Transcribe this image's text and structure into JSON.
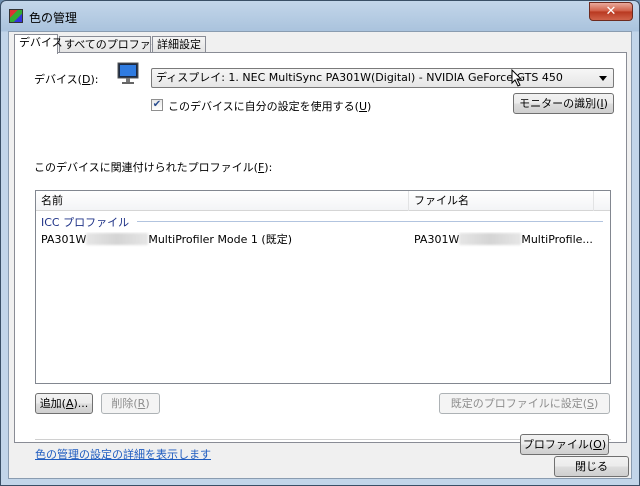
{
  "window": {
    "title": "色の管理",
    "close_label": "✕"
  },
  "tabs": [
    {
      "label": "デバイス",
      "active": true
    },
    {
      "label": "すべてのプロファイル",
      "active": false
    },
    {
      "label": "詳細設定",
      "active": false
    }
  ],
  "device": {
    "label_prefix": "デバイス(",
    "label_key": "D",
    "label_suffix": "):",
    "selected": "ディスプレイ: 1. NEC MultiSync PA301W(Digital) - NVIDIA GeForce GTS 450",
    "use_settings_checked": true,
    "use_settings_prefix": "このデバイスに自分の設定を使用する(",
    "use_settings_key": "U",
    "use_settings_suffix": ")",
    "identify_prefix": "モニターの識別(",
    "identify_key": "I",
    "identify_suffix": ")"
  },
  "profiles": {
    "label_prefix": "このデバイスに関連付けられたプロファイル(",
    "label_key": "F",
    "label_suffix": "):",
    "columns": [
      "名前",
      "ファイル名"
    ],
    "group": "ICC プロファイル",
    "rows": [
      {
        "name_start": "PA301W",
        "name_end": "MultiProfiler Mode 1 (既定)",
        "file_start": "PA301W",
        "file_end": "MultiProfile..."
      }
    ]
  },
  "buttons": {
    "add_prefix": "追加(",
    "add_key": "A",
    "add_suffix": ")...",
    "remove_prefix": "削除(",
    "remove_key": "R",
    "remove_suffix": ")",
    "set_default_prefix": "既定のプロファイルに設定(",
    "set_default_key": "S",
    "set_default_suffix": ")",
    "profile_prefix": "プロファイル(",
    "profile_key": "O",
    "profile_suffix": ")",
    "close": "閉じる"
  },
  "link": "色の管理の設定の詳細を表示します",
  "colors": {
    "link": "#1f5cc0",
    "group_header": "#1e3287",
    "title_bar": "#aac3dd"
  }
}
